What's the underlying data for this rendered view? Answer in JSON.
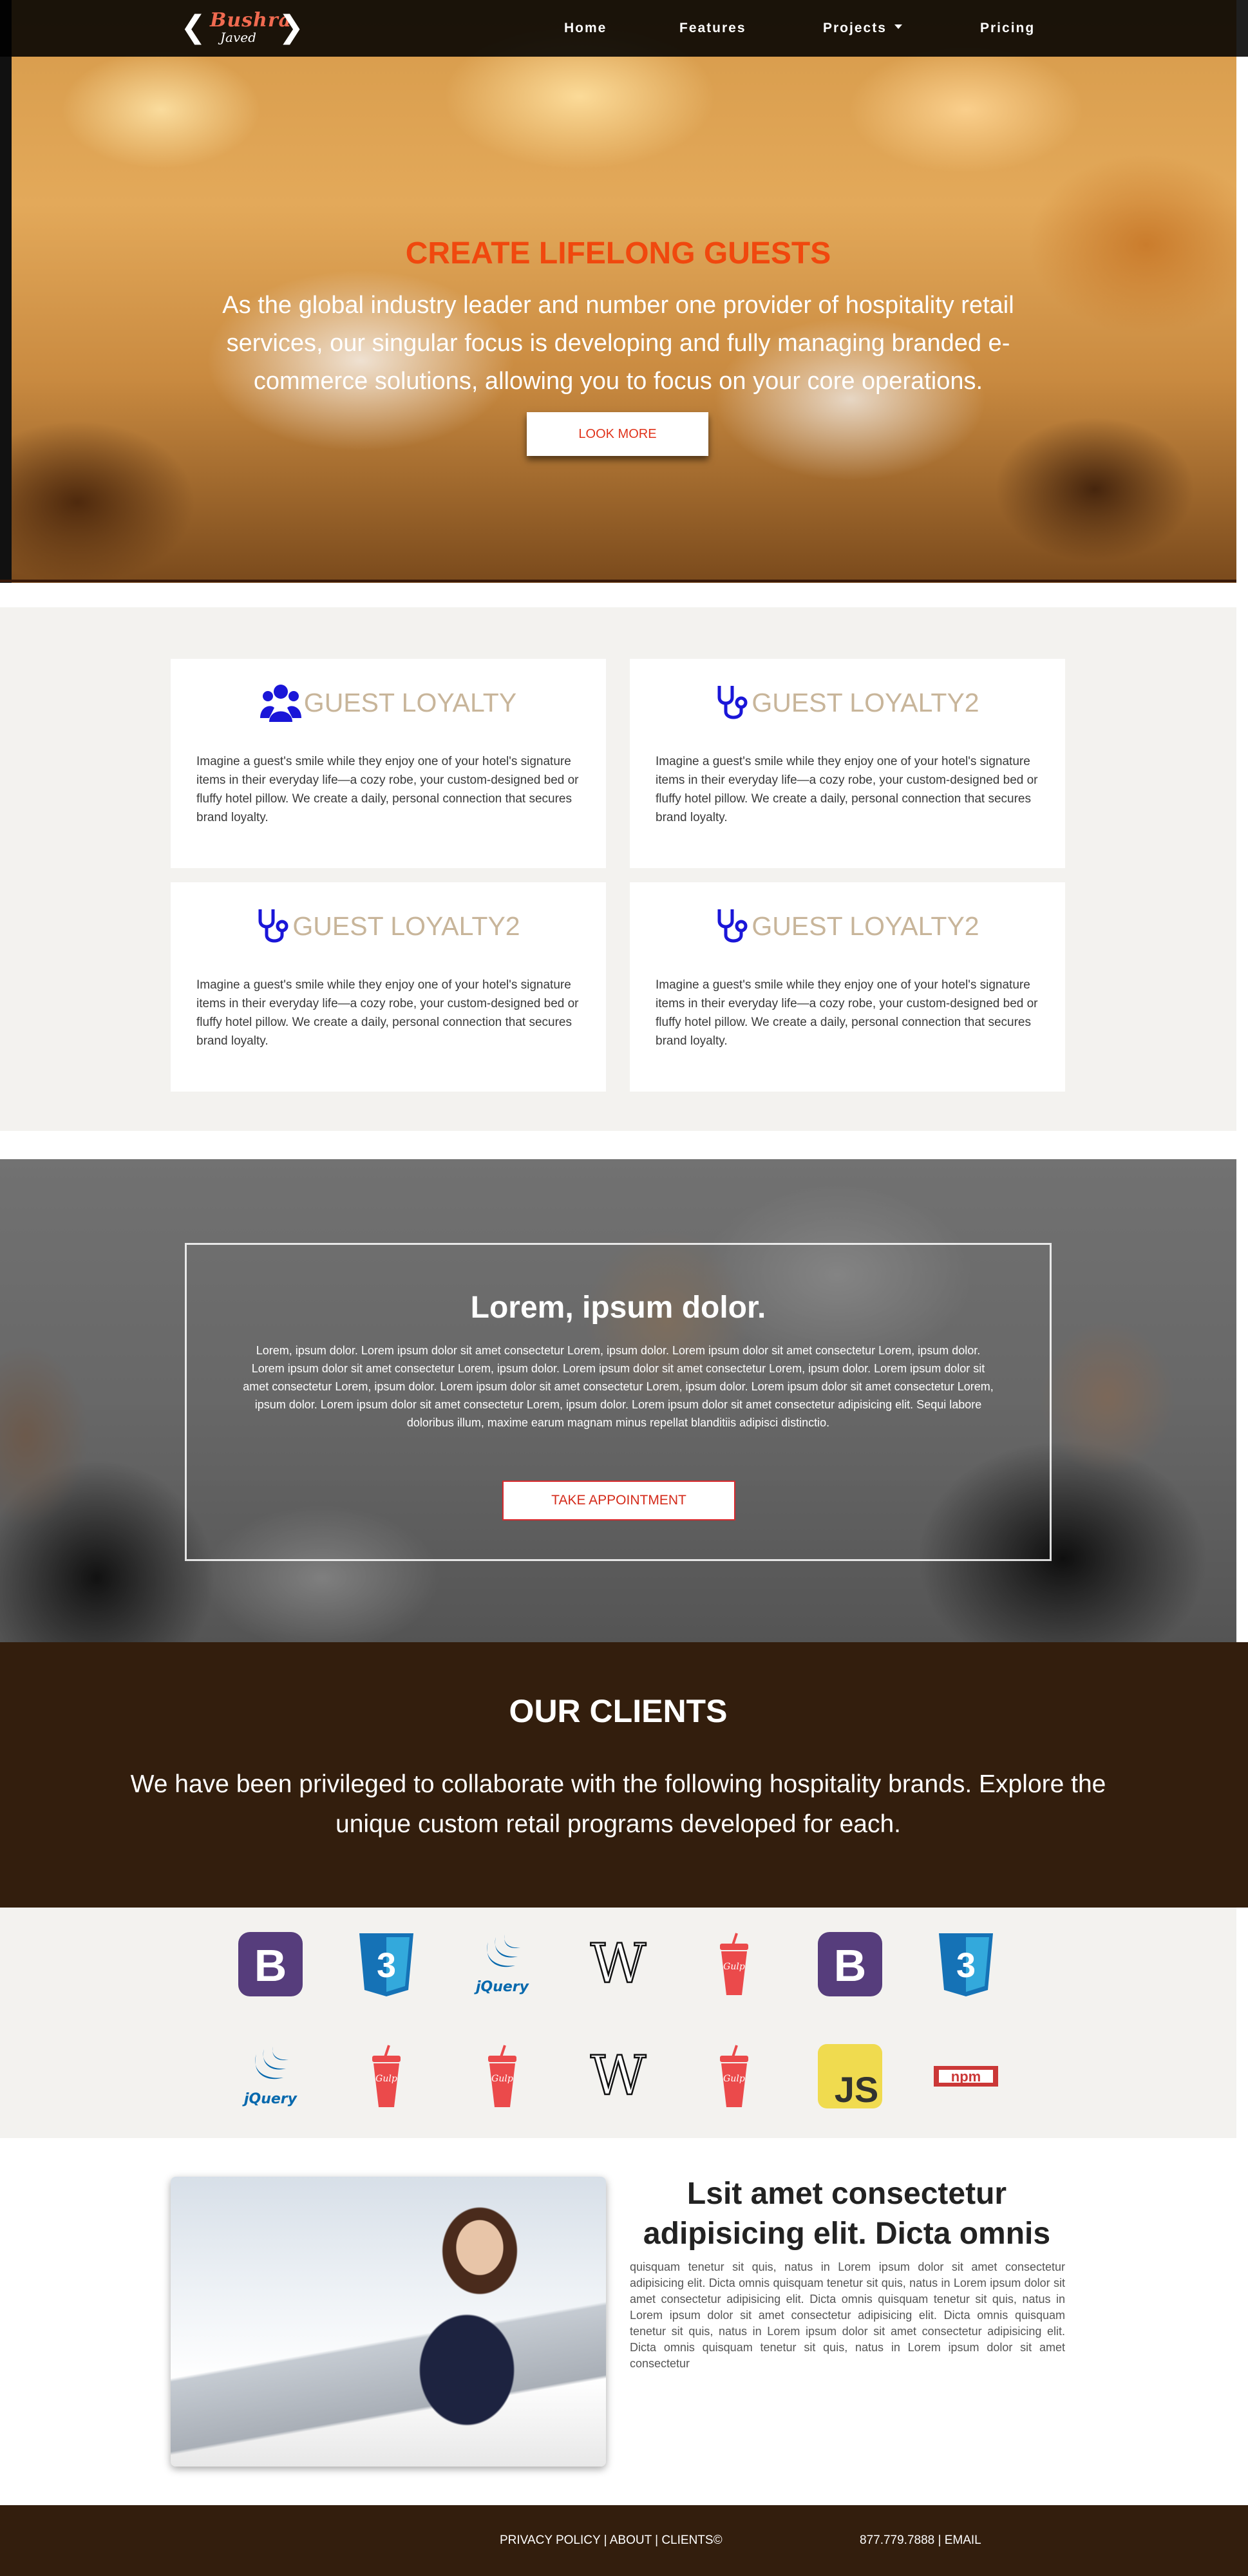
{
  "nav": {
    "logo_main": "Bushra",
    "logo_sub": "Javed",
    "items": [
      "Home",
      "Features",
      "Projects",
      "Pricing"
    ]
  },
  "hero": {
    "title": "CREATE LIFELONG GUESTS",
    "text": "As the global industry leader and number one provider of hospitality retail services, our singular focus is developing and fully managing branded e-commerce solutions, allowing you to focus on your core operations.",
    "button": "LOOK MORE"
  },
  "features": {
    "cards": [
      {
        "icon": "users-icon",
        "title": "GUEST LOYALTY",
        "text": "Imagine a guest's smile while they enjoy one of your hotel's signature items in their everyday life—a cozy robe, your custom-designed bed or fluffy hotel pillow. We create a daily, personal connection that secures brand loyalty."
      },
      {
        "icon": "stethoscope-icon",
        "title": "GUEST LOYALTY2",
        "text": "Imagine a guest's smile while they enjoy one of your hotel's signature items in their everyday life—a cozy robe, your custom-designed bed or fluffy hotel pillow. We create a daily, personal connection that secures brand loyalty."
      },
      {
        "icon": "stethoscope-icon",
        "title": "GUEST LOYALTY2",
        "text": "Imagine a guest's smile while they enjoy one of your hotel's signature items in their everyday life—a cozy robe, your custom-designed bed or fluffy hotel pillow. We create a daily, personal connection that secures brand loyalty."
      },
      {
        "icon": "stethoscope-icon",
        "title": "GUEST LOYALTY2",
        "text": "Imagine a guest's smile while they enjoy one of your hotel's signature items in their everyday life—a cozy robe, your custom-designed bed or fluffy hotel pillow. We create a daily, personal connection that secures brand loyalty."
      }
    ],
    "icon_color": "#1a16d8",
    "title_color": "#c8b59a"
  },
  "team": {
    "title": "Lorem, ipsum dolor.",
    "text": "Lorem, ipsum dolor. Lorem ipsum dolor sit amet consectetur Lorem, ipsum dolor. Lorem ipsum dolor sit amet consectetur Lorem, ipsum dolor. Lorem ipsum dolor sit amet consectetur Lorem, ipsum dolor. Lorem ipsum dolor sit amet consectetur Lorem, ipsum dolor. Lorem ipsum dolor sit amet consectetur Lorem, ipsum dolor. Lorem ipsum dolor sit amet consectetur Lorem, ipsum dolor. Lorem ipsum dolor sit amet consectetur Lorem, ipsum dolor. Lorem ipsum dolor sit amet consectetur Lorem, ipsum dolor. Lorem ipsum dolor sit amet consectetur adipisicing elit. Sequi labore doloribus illum, maxime earum magnam minus repellat blanditiis adipisci distinctio.",
    "button": "TAKE APPOINTMENT"
  },
  "clients": {
    "title": "OUR CLIENTS",
    "text": "We have been privileged to collaborate with the following hospitality brands. Explore the unique custom retail programs developed for each."
  },
  "logos": {
    "row1": [
      "bootstrap-icon",
      "css3-icon",
      "jquery-icon",
      "wikipedia-icon",
      "gulp-icon",
      "bootstrap-icon",
      "css3-icon"
    ],
    "row2": [
      "jquery-icon",
      "gulp-icon",
      "gulp-icon",
      "wikipedia-icon",
      "gulp-icon",
      "javascript-icon",
      "npm-icon"
    ],
    "labels": {
      "bootstrap": "B",
      "css3": "3",
      "jquery": "jQuery",
      "wikipedia": "W",
      "gulp": "Gulp",
      "javascript": "JS",
      "npm": "npm"
    },
    "colors": {
      "bootstrap": "#563d7c",
      "css3": "#1572b6",
      "jquery": "#0769ad",
      "gulp": "#eb4a4b",
      "javascript": "#f0db4f",
      "npm": "#cb3837"
    }
  },
  "about": {
    "title": "Lsit amet consectetur adipisicing elit. Dicta omnis",
    "text": "quisquam tenetur sit quis, natus in Lorem ipsum dolor sit amet consectetur adipisicing elit. Dicta omnis quisquam tenetur sit quis, natus in Lorem ipsum dolor sit amet consectetur adipisicing elit. Dicta omnis quisquam tenetur sit quis, natus in Lorem ipsum dolor sit amet consectetur adipisicing elit. Dicta omnis quisquam tenetur sit quis, natus in Lorem ipsum dolor sit amet consectetur adipisicing elit. Dicta omnis quisquam tenetur sit quis, natus in Lorem ipsum dolor sit amet consectetur"
  },
  "footer": {
    "links": "PRIVACY POLICY | ABOUT | CLIENTS©",
    "contact": "877.779.7888 | EMAIL"
  }
}
